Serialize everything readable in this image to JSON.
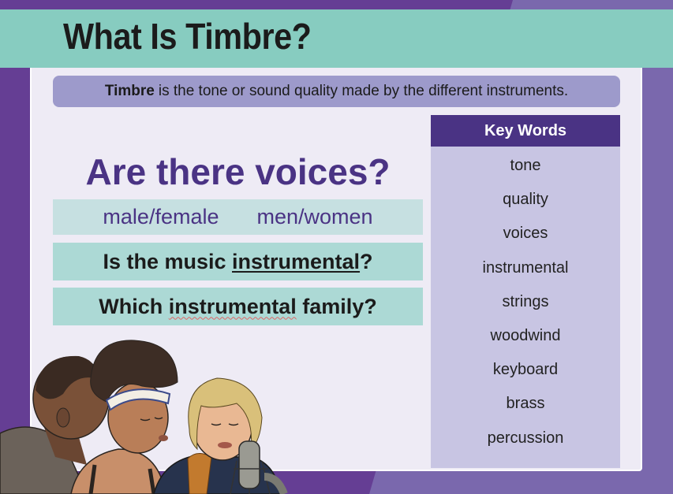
{
  "slide": {
    "title": "What Is Timbre?",
    "definition": {
      "term": "Timbre",
      "text": "is the tone or sound quality made by the different instruments."
    },
    "voices_question": "Are there voices?",
    "voice_options": [
      "male/female",
      "men/women"
    ],
    "question_instrumental": {
      "prefix": "Is the music ",
      "keyword": "instrumental",
      "suffix": "?"
    },
    "question_family": {
      "prefix": "Which ",
      "keyword": "instrumental",
      "suffix": " family?"
    },
    "key_words": {
      "heading": "Key Words",
      "items": [
        "tone",
        "quality",
        "voices",
        "instrumental",
        "strings",
        "woodwind",
        "keyboard",
        "brass",
        "percussion"
      ]
    },
    "illustration": "three-singers-with-microphone"
  },
  "colors": {
    "bg_dark_purple": "#653e94",
    "bg_light_purple": "#7a68ad",
    "title_bar_teal": "#87ccc0",
    "panel": "#eeebf5",
    "definition_box": "#9d9acb",
    "keywords_header": "#4a3384",
    "keywords_body": "#c8c5e3",
    "question_purple": "#4a3384",
    "voice_box": "#c6e0e1",
    "question_box": "#acd9d5"
  }
}
